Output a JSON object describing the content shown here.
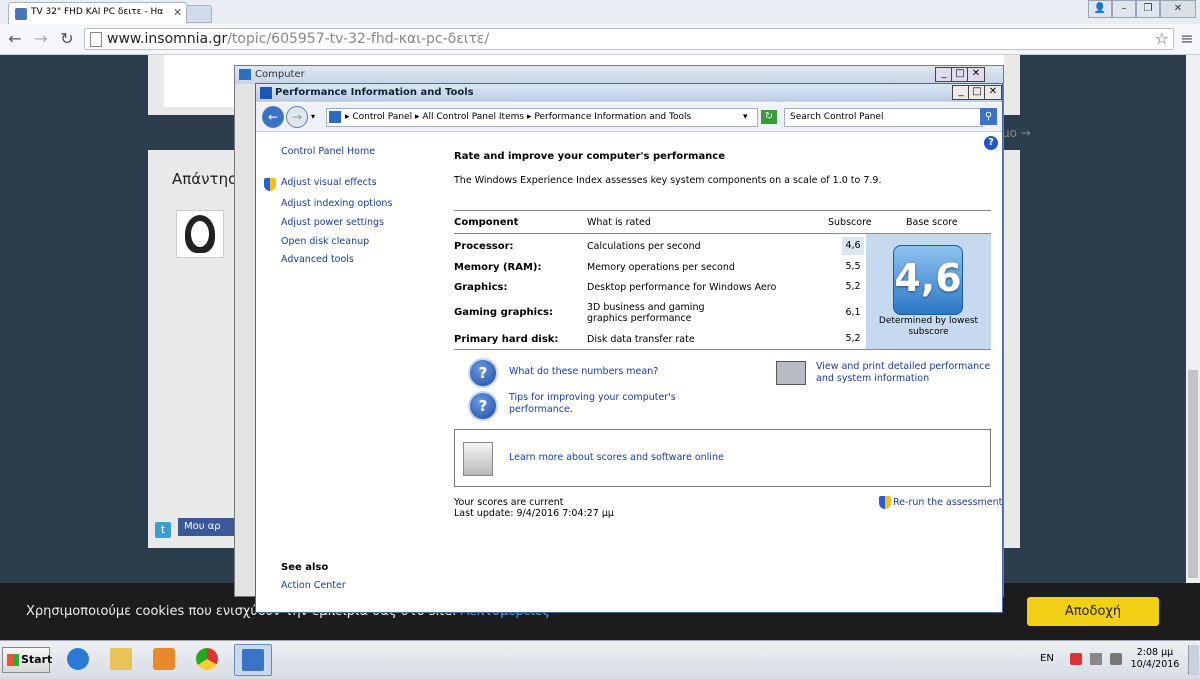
{
  "browser": {
    "tab_title": "TV 32\" FHD ΚΑΙ PC δειτε - Ηα",
    "url_host": "www.insomnia.gr",
    "url_path": "/topic/605957-tv-32-fhd-και-pc-δειτε/",
    "window_controls": [
      "user-icon",
      "minimize-icon",
      "restore-icon",
      "close-icon"
    ]
  },
  "page": {
    "reply_heading": "Απάντηση",
    "pager_arrow": "μο →",
    "facebook_button": "Μου αρ",
    "cookie_text": "Χρησιμοποιούμε cookies που ενισχύουν την εμπειρία σας στο site.",
    "cookie_link": "Λεπτομέρειες",
    "accept_label": "Αποδοχή"
  },
  "computer_window": {
    "title": "Computer"
  },
  "perf_window": {
    "title": "Performance Information and Tools",
    "breadcrumb": [
      "Control Panel",
      "All Control Panel Items",
      "Performance Information and Tools"
    ],
    "search_placeholder": "Search Control Panel",
    "sidebar": {
      "home": "Control Panel Home",
      "links": [
        "Adjust visual effects",
        "Adjust indexing options",
        "Adjust power settings",
        "Open disk cleanup",
        "Advanced tools"
      ],
      "see_also": "See also",
      "action_center": "Action Center"
    },
    "heading": "Rate and improve your computer's performance",
    "description": "The Windows Experience Index assesses key system components on a scale of 1.0 to 7.9.",
    "table": {
      "headers": [
        "Component",
        "What is rated",
        "Subscore",
        "Base score"
      ],
      "rows": [
        {
          "component": "Processor:",
          "rated": "Calculations per second",
          "subscore": "4,6"
        },
        {
          "component": "Memory (RAM):",
          "rated": "Memory operations per second",
          "subscore": "5,5"
        },
        {
          "component": "Graphics:",
          "rated": "Desktop performance for Windows Aero",
          "subscore": "5,2"
        },
        {
          "component": "Gaming graphics:",
          "rated": "3D business and gaming graphics performance",
          "subscore": "6,1"
        },
        {
          "component": "Primary hard disk:",
          "rated": "Disk data transfer rate",
          "subscore": "5,2"
        }
      ],
      "base_score": "4,6",
      "base_caption": "Determined by lowest subscore"
    },
    "links": {
      "numbers": "What do these numbers mean?",
      "tips": "Tips for improving your computer's performance.",
      "print": "View and print detailed performance and system information",
      "learn": "Learn more about scores and software online"
    },
    "status": {
      "current": "Your scores are current",
      "last_update": "Last update: 9/4/2016 7:04:27 μμ",
      "rerun": "Re-run the assessment"
    }
  },
  "taskbar": {
    "start": "Start",
    "lang": "EN",
    "time": "2:08 μμ",
    "date": "10/4/2016"
  }
}
